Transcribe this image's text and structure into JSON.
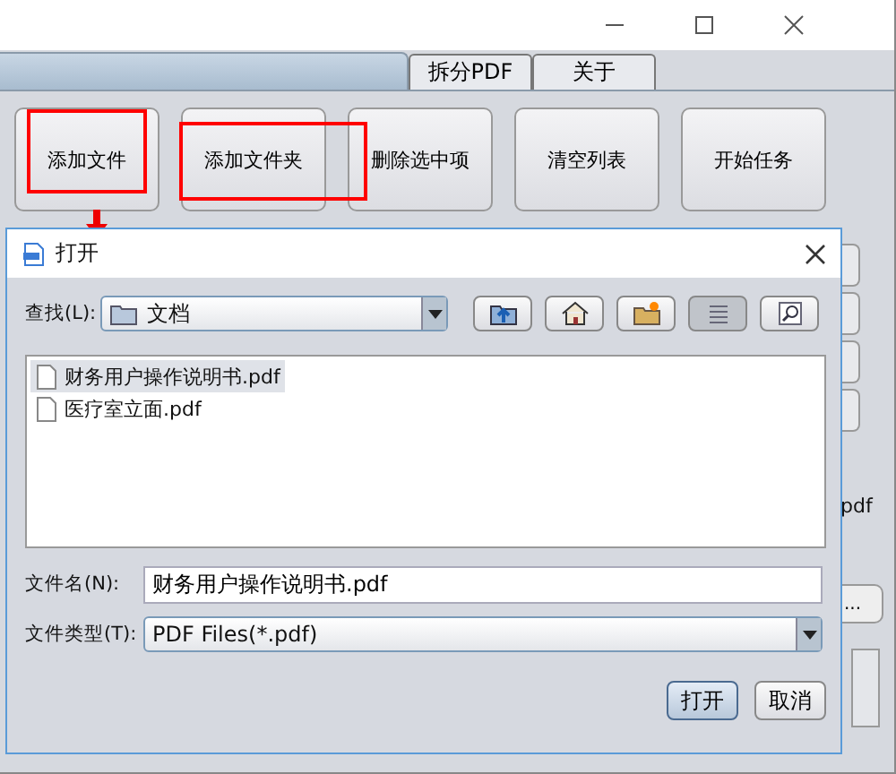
{
  "tabs": [
    {
      "label": "拆分PDF",
      "selected": false
    },
    {
      "label": "关于",
      "selected": false
    }
  ],
  "buttons": [
    "添加文件",
    "添加文件夹",
    "删除选中项",
    "清空列表",
    "开始任务"
  ],
  "background": {
    "list_fragment": "pdf",
    "browse_button": "..."
  },
  "dialog": {
    "title": "打开",
    "look_in_label": "查找(L):",
    "look_in_value": "文档",
    "toolbar": [
      {
        "kind": "up",
        "pressed": false
      },
      {
        "kind": "home",
        "pressed": false
      },
      {
        "kind": "new-folder",
        "pressed": false
      },
      {
        "kind": "list",
        "pressed": true
      },
      {
        "kind": "details",
        "pressed": false
      }
    ],
    "files": [
      {
        "name": "财务用户操作说明书.pdf",
        "selected": true
      },
      {
        "name": "医疗室立面.pdf",
        "selected": false
      }
    ],
    "file_name_label": "文件名(N):",
    "file_name_value": "财务用户操作说明书.pdf",
    "file_type_label": "文件类型(T):",
    "file_type_value": "PDF Files(*.pdf)",
    "buttons": [
      {
        "label": "打开",
        "default": true
      },
      {
        "label": "取消",
        "default": false
      }
    ]
  }
}
